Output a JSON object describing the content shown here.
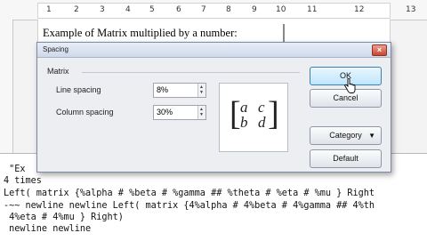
{
  "ruler": {
    "numbers": [
      "1",
      "2",
      "3",
      "4",
      "5",
      "6",
      "7",
      "8",
      "9",
      "10",
      "11",
      "12",
      "13"
    ]
  },
  "document": {
    "heading": "Example of Matrix multiplied by a number:"
  },
  "dialog": {
    "title": "Spacing",
    "close_label": "×",
    "group_label": "Matrix",
    "line_spacing_label": "Line spacing",
    "line_spacing_value": "8%",
    "column_spacing_label": "Column spacing",
    "column_spacing_value": "30%",
    "buttons": {
      "ok": "OK",
      "cancel": "Cancel",
      "category": "Category",
      "default": "Default"
    },
    "preview_cells": [
      "a",
      "c",
      "b",
      "d"
    ]
  },
  "editor": {
    "lines": [
      " \"Ex",
      "4 times",
      "Left( matrix {%alpha # %beta # %gamma ## %theta # %eta # %mu } Right",
      "-~~ newline newline Left( matrix {4%alpha # 4%beta # 4%gamma ## 4%th",
      " 4%eta # 4%mu } Right)",
      " newline newline"
    ]
  },
  "colors": {
    "ok_button": "#bee6fd",
    "close_button": "#c8452f",
    "dialog_bg": "#eceef2"
  }
}
